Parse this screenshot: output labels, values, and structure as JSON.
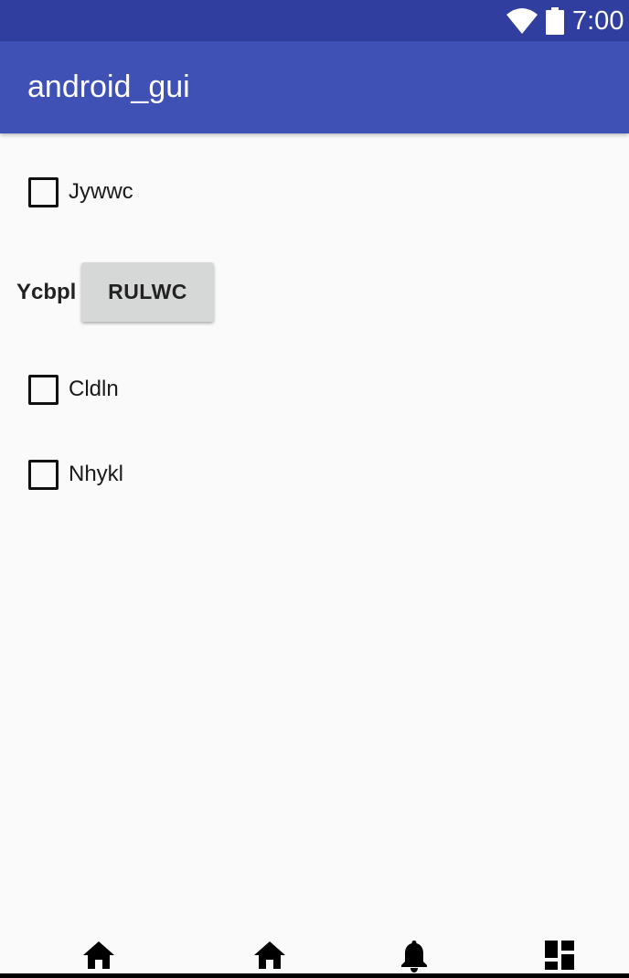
{
  "status_bar": {
    "time": "7:00",
    "icons": [
      "wifi-icon",
      "battery-icon"
    ]
  },
  "app_bar": {
    "title": "android_gui"
  },
  "main": {
    "checkboxes": [
      {
        "label": "Jywwc",
        "checked": false
      },
      {
        "label": "Cldln",
        "checked": false
      },
      {
        "label": "Nhykl",
        "checked": false
      }
    ],
    "field_label": "Ycbpl",
    "button_label": "RULWC"
  },
  "nav_bar": {
    "icons": [
      "home-icon",
      "home-icon",
      "bell-icon",
      "dashboard-icon"
    ]
  },
  "colors": {
    "status_bar": "#303f9f",
    "app_bar": "#3f51b5",
    "background": "#fafafa",
    "button": "#d6d7d7"
  }
}
